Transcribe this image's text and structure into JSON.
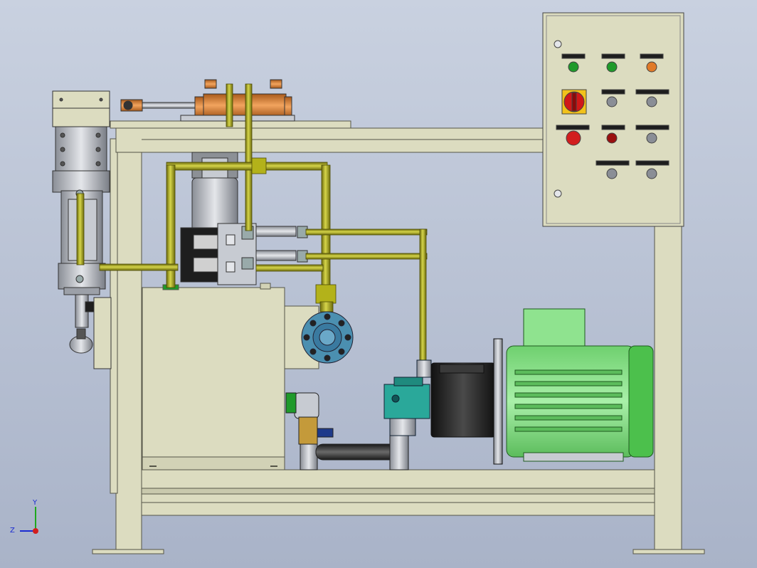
{
  "view": {
    "background_top": "#c9d1e0",
    "background_bottom": "#a9b3c8",
    "axis_triad": {
      "y": "Y",
      "z": "Z"
    }
  },
  "colors": {
    "frame": "#dcdcc0",
    "frame_edge": "#555548",
    "pipe": "#b3b21a",
    "pipe_edge": "#4b4a06",
    "motor_green": "#8fe38f",
    "pump_teal": "#2aa89a",
    "copper": "#e3863a",
    "steel": "#b8bcc4",
    "dark": "#1e1e1e",
    "lamp_green": "#1f9a2a",
    "lamp_orange": "#e07a28",
    "lamp_red": "#d21e1e",
    "selector_red": "#d01818",
    "flange_blue": "#4b8fb0"
  },
  "control_panel": {
    "indicator_lamps": [
      {
        "color": "green"
      },
      {
        "color": "green"
      },
      {
        "color": "orange"
      }
    ],
    "main_switch": {
      "type": "red rotary isolator"
    },
    "buttons_row2": [
      {
        "color": "grey"
      },
      {
        "color": "grey"
      }
    ],
    "buttons_row3": [
      {
        "color": "red"
      },
      {
        "color": "dark-red"
      },
      {
        "color": "grey"
      }
    ],
    "buttons_row4": [
      {
        "color": "grey"
      },
      {
        "color": "grey"
      }
    ]
  },
  "components": [
    "base-frame",
    "hydraulic-cylinder",
    "oil-tank",
    "oil-filter",
    "manifold-block",
    "gear-pump",
    "electric-motor",
    "bell-housing",
    "flow-valve",
    "control-panel"
  ]
}
